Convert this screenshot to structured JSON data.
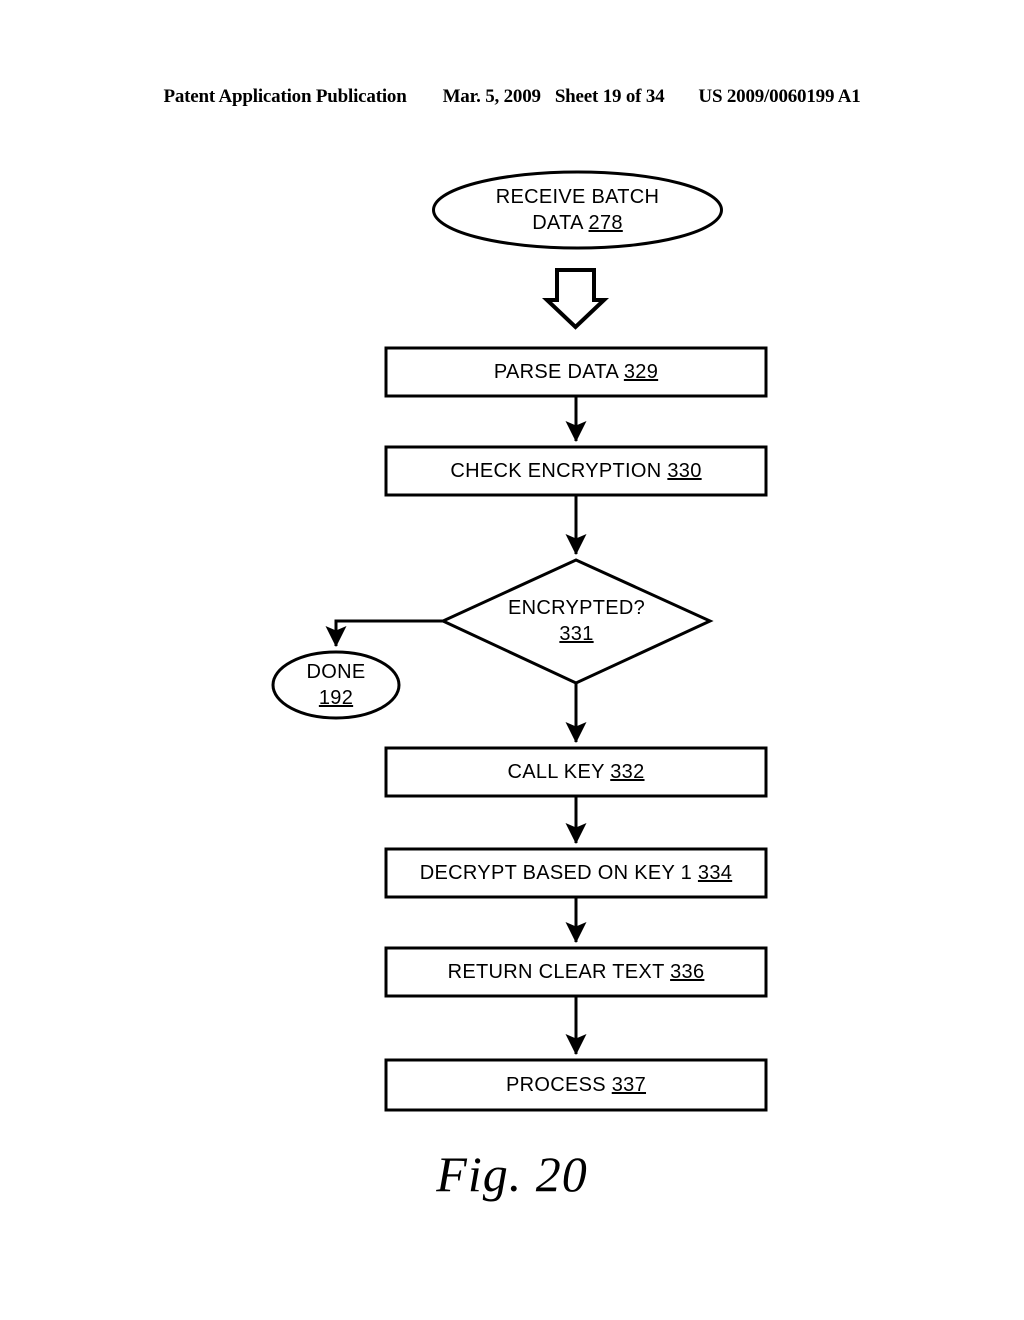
{
  "header": {
    "publication": "Patent Application Publication",
    "date": "Mar. 5, 2009",
    "sheet": "Sheet 19 of 34",
    "patent_number": "US 2009/0060199 A1"
  },
  "figure": {
    "caption": "Fig. 20"
  },
  "flowchart": {
    "nodes": [
      {
        "id": "receive-batch-data",
        "shape": "oval",
        "lines": [
          "RECEIVE BATCH",
          "DATA"
        ],
        "ref": "278",
        "text": "RECEIVE BATCH DATA 278"
      },
      {
        "id": "parse-data",
        "shape": "rectangle",
        "lines": [
          "PARSE DATA"
        ],
        "ref": "329",
        "text": "PARSE DATA 329"
      },
      {
        "id": "check-encryption",
        "shape": "rectangle",
        "lines": [
          "CHECK ENCRYPTION"
        ],
        "ref": "330",
        "text": "CHECK ENCRYPTION 330"
      },
      {
        "id": "encrypted-decision",
        "shape": "diamond",
        "lines": [
          "ENCRYPTED?"
        ],
        "ref": "331",
        "text": "ENCRYPTED? 331"
      },
      {
        "id": "done",
        "shape": "oval",
        "lines": [
          "DONE"
        ],
        "ref": "192",
        "text": "DONE 192"
      },
      {
        "id": "call-key",
        "shape": "rectangle",
        "lines": [
          "CALL KEY"
        ],
        "ref": "332",
        "text": "CALL KEY 332"
      },
      {
        "id": "decrypt-based-on-key-1",
        "shape": "rectangle",
        "lines": [
          "DECRYPT BASED ON KEY 1"
        ],
        "ref": "334",
        "text": "DECRYPT BASED ON KEY 1 334"
      },
      {
        "id": "return-clear-text",
        "shape": "rectangle",
        "lines": [
          "RETURN CLEAR TEXT"
        ],
        "ref": "336",
        "text": "RETURN CLEAR TEXT 336"
      },
      {
        "id": "process",
        "shape": "rectangle",
        "lines": [
          "PROCESS"
        ],
        "ref": "337",
        "text": "PROCESS 337"
      }
    ],
    "connectors": [
      {
        "id": "receive-to-parse",
        "style": "block-arrow",
        "from": "receive-batch-data",
        "to": "parse-data"
      },
      {
        "id": "parse-to-check",
        "style": "line-arrow",
        "from": "parse-data",
        "to": "check-encryption"
      },
      {
        "id": "check-to-encrypted",
        "style": "line-arrow",
        "from": "check-encryption",
        "to": "encrypted-decision"
      },
      {
        "id": "encrypted-to-done",
        "style": "elbow-arrow",
        "from": "encrypted-decision",
        "to": "done"
      },
      {
        "id": "encrypted-to-call-key",
        "style": "line-arrow",
        "from": "encrypted-decision",
        "to": "call-key"
      },
      {
        "id": "call-key-to-decrypt",
        "style": "line-arrow",
        "from": "call-key",
        "to": "decrypt-based-on-key-1"
      },
      {
        "id": "decrypt-to-return",
        "style": "line-arrow",
        "from": "decrypt-based-on-key-1",
        "to": "return-clear-text"
      },
      {
        "id": "return-to-process",
        "style": "line-arrow",
        "from": "return-clear-text",
        "to": "process"
      }
    ],
    "colors": {
      "stroke": "#000000",
      "fill": "#ffffff",
      "background": "#ffffff"
    }
  }
}
